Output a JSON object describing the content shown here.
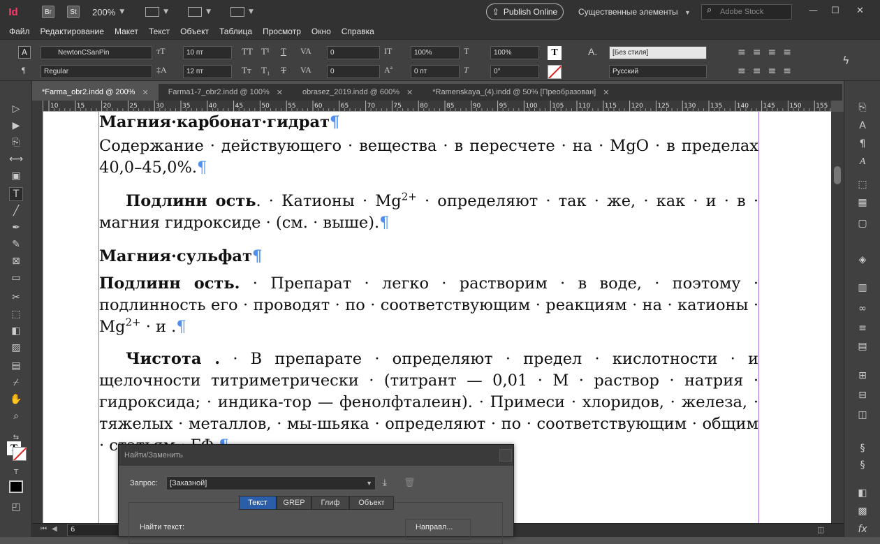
{
  "app": {
    "logo": "Id",
    "bridge": "Br",
    "stock_label": "St",
    "zoom": "200%",
    "publish_label": "Publish Online",
    "workspace": "Существенные элементы",
    "search_placeholder": "Adobe Stock"
  },
  "menu": [
    "Файл",
    "Редактирование",
    "Макет",
    "Текст",
    "Объект",
    "Таблица",
    "Просмотр",
    "Окно",
    "Справка"
  ],
  "control": {
    "font_family": "NewtonCSanPin",
    "font_style": "Regular",
    "font_size": "10 пт",
    "leading": "12 пт",
    "kerning": "0",
    "tracking": "0",
    "vscale": "100%",
    "hscale": "100%",
    "baseline": "0 пт",
    "skew": "0°",
    "para_style": "[Без стиля]",
    "language": "Русский",
    "tt_label": "TT",
    "tsup_label": "T¹",
    "tu_label": "T",
    "tt2_label": "Tт",
    "tsub_label": "T₁",
    "ts_label": "T",
    "a_label": "A.",
    "pilcrow": "¶"
  },
  "tabs": [
    {
      "label": "*Farma_obr2.indd @ 200%",
      "active": true
    },
    {
      "label": "Farma1-7_obr2.indd @ 100%",
      "active": false
    },
    {
      "label": "obrasez_2019.indd @ 600%",
      "active": false
    },
    {
      "label": "*Ramenskaya_(4).indd @ 50% [Преобразован]",
      "active": false
    }
  ],
  "ruler_ticks": [
    "10",
    "15",
    "20",
    "25",
    "30",
    "35",
    "40",
    "45",
    "50",
    "55",
    "60",
    "65",
    "70",
    "75",
    "80",
    "85",
    "90",
    "95",
    "100",
    "105",
    "110",
    "115",
    "120",
    "125",
    "130",
    "135",
    "140",
    "145",
    "150",
    "155"
  ],
  "document": {
    "h1": "Магния·карбонат·гидрат",
    "p1": "Содержание · действующего · вещества · в пересчете · на · MgO · в пределах 40,0–45,0%.",
    "p2_bold": "Подлинн ость",
    "p2_text": ". · Катионы · Mg",
    "p2_sup": "2+",
    "p2_rest": " · определяют · так · же, · как · и · в · магния гидроксиде · (см. · выше).",
    "h2": "Магния·сульфат",
    "p3_bold": "Подлинн ость.",
    "p3_text": " · Препарат · легко · растворим · в воде, · поэтому · подлинность его · проводят · по · соответствующим · реакциям · на · катионы · Mg",
    "p3_sup": "2+",
    "p3_rest": " · и .",
    "p4_bold": "Чистота .",
    "p4_text": " · В препарате · определяют · предел · кислотности · и щелочности титриметрически · (титрант — 0,01 · М · раствор · натрия · гидроксида; · индика-тор — фенолфталеин). · Примеси · хлоридов, · железа, · тяжелых · металлов, · мы-шьяка · определяют · по · соответствующим · общим · статьям · ГФ.",
    "pilcrow": "¶"
  },
  "dialog": {
    "title": "Найти/Заменить",
    "query_label": "Запрос:",
    "query_value": "[Заказной]",
    "tabs": [
      "Текст",
      "GREP",
      "Глиф",
      "Объект"
    ],
    "find_label": "Найти текст:",
    "direction_label": "Направл..."
  },
  "status": {
    "page": "6"
  }
}
